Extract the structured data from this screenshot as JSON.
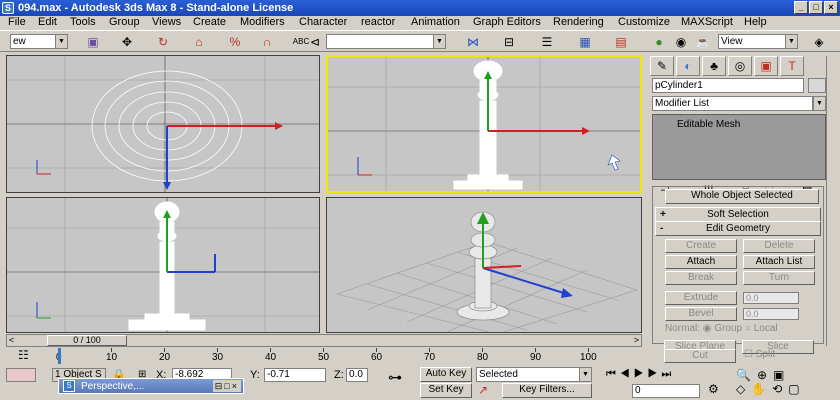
{
  "window": {
    "title": "094.max - Autodesk 3ds Max 8  - Stand-alone License",
    "icon": "S"
  },
  "menu": [
    "File",
    "Edit",
    "Tools",
    "Group",
    "Views",
    "Create",
    "Modifiers",
    "Character",
    "reactor",
    "Animation",
    "Graph Editors",
    "Rendering",
    "Customize",
    "MAXScript",
    "Help"
  ],
  "toolbar": {
    "selection_filter": "ew",
    "named_selection": "",
    "ref_coord": "View"
  },
  "viewports": {
    "active": "top-right"
  },
  "command_panel": {
    "object_name": "pCylinder1",
    "modifier_list": "Modifier List",
    "stack_item": "Editable Mesh",
    "selection_status": "Whole Object Selected",
    "soft_selection": {
      "sign": "+",
      "label": "Soft Selection"
    },
    "edit_geometry": {
      "sign": "-",
      "label": "Edit Geometry"
    },
    "buttons": {
      "create": "Create",
      "delete": "Delete",
      "attach": "Attach",
      "attach_list": "Attach List",
      "break": "Break",
      "turn": "Turn",
      "extrude": "Extrude",
      "bevel": "Bevel",
      "extrude_val": "0.0",
      "bevel_val": "0.0",
      "normal": "Normal:",
      "group": "Group",
      "local": "Local",
      "slice_plane": "Slice Plane",
      "slice": "Slice",
      "cut": "Cut",
      "split": "Split"
    }
  },
  "timeline": {
    "slider": "0 / 100",
    "ticks": [
      "0",
      "10",
      "20",
      "30",
      "40",
      "50",
      "60",
      "70",
      "80",
      "90",
      "100"
    ]
  },
  "status_bar": {
    "selection_count": "1 Object S",
    "x_label": "X:",
    "x_value": "-8.692",
    "y_label": "Y:",
    "y_value": "-0.71",
    "z_label": "Z:",
    "z_value": "0.0",
    "auto_key": "Auto Key",
    "set_key": "Set Key",
    "key_mode": "Selected",
    "key_filters": "Key Filters...",
    "current_frame": "0",
    "taskbar_window": "Perspective,..."
  }
}
